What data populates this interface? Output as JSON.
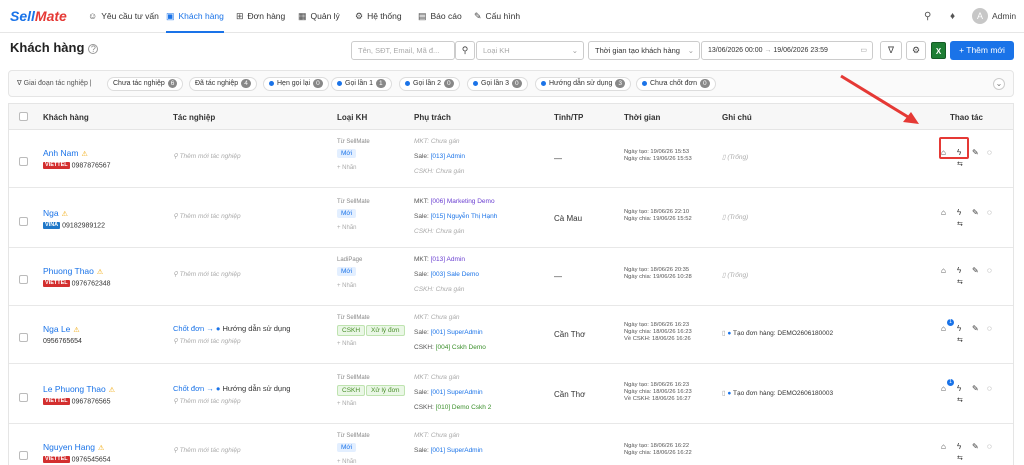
{
  "nav": {
    "logo_a": "Sell",
    "logo_b": "Mate",
    "items": [
      {
        "label": "Yêu cầu tư vấn",
        "icon": "chat-icon"
      },
      {
        "label": "Khách hàng",
        "icon": "contact-icon"
      },
      {
        "label": "Đơn hàng",
        "icon": "cart-icon"
      },
      {
        "label": "Quản lý",
        "icon": "grid-icon"
      },
      {
        "label": "Hệ thống",
        "icon": "gear-icon"
      },
      {
        "label": "Báo cáo",
        "icon": "chart-icon"
      },
      {
        "label": "Cấu hình",
        "icon": "wrench-icon"
      }
    ],
    "avatar_letter": "A",
    "user": "Admin"
  },
  "page": {
    "title": "Khách hàng",
    "search_placeholder": "Tên, SĐT, Email, Mã đ...",
    "type_placeholder": "Loại KH",
    "time_filter": "Thời gian tạo khách hàng",
    "date_from": "13/06/2026 00:00",
    "date_to": "19/06/2026 23:59",
    "date_sep": "→",
    "excel": "X",
    "add_button": "+ Thêm mới"
  },
  "filters": {
    "label": "Giai đoạn tác nghiệp",
    "chips": [
      {
        "label": "Chưa tác nghiệp",
        "count": "6"
      },
      {
        "label": "Đã tác nghiệp",
        "count": "4"
      },
      {
        "label": "Hẹn gọi lại",
        "count": "0"
      },
      {
        "label": "Gọi lần 1",
        "count": "1"
      },
      {
        "label": "Gọi lần 2",
        "count": "0"
      },
      {
        "label": "Gọi lần 3",
        "count": "0"
      },
      {
        "label": "Hướng dẫn sử dụng",
        "count": "3"
      },
      {
        "label": "Chưa chốt đơn",
        "count": "0"
      }
    ]
  },
  "table": {
    "headers": [
      "Khách hàng",
      "Tác nghiệp",
      "Loại KH",
      "Phụ trách",
      "Tỉnh/TP",
      "Thời gian",
      "Ghi chú",
      "Thao tác"
    ],
    "add_tn": "Thêm mới tác nghiệp",
    "add_label": "+ Nhãn",
    "empty_note": "(Trống)",
    "rows": [
      {
        "name": "Anh Nam",
        "carrier": "VIETTEL",
        "phone": "0987876567",
        "tn_stage": "",
        "tn_status": "",
        "source": "Từ SellMate",
        "tag": "Mới",
        "tag2": "",
        "mkt": "MKT: Chưa gán",
        "sale": "Sale: ",
        "sale_v": "[013] Admin",
        "cskh": "CSKH: Chưa gán",
        "cskh_v": "",
        "city": "—",
        "t1": "Ngày tạo: 19/06/26 15:53",
        "t2": "Ngày chia: 19/06/26 15:53",
        "t3": "",
        "note": "(Trống)"
      },
      {
        "name": "Nga",
        "carrier": "VINA",
        "phone": "09182989122",
        "tn_stage": "",
        "tn_status": "",
        "source": "Từ SellMate",
        "tag": "Mới",
        "tag2": "",
        "mkt": "MKT: ",
        "mkt_v": "[006] Marketing Demo",
        "sale": "Sale: ",
        "sale_v": "[015] Nguyễn Thị Hạnh",
        "cskh": "CSKH: Chưa gán",
        "cskh_v": "",
        "city": "Cà Mau",
        "t1": "Ngày tạo: 18/06/26 22:10",
        "t2": "Ngày chia: 19/06/26 15:52",
        "t3": "",
        "note": "(Trống)"
      },
      {
        "name": "Phuong Thao",
        "carrier": "VIETTEL",
        "phone": "0976762348",
        "tn_stage": "",
        "tn_status": "",
        "source": "LadiPage",
        "tag": "Mới",
        "tag2": "",
        "mkt": "MKT: ",
        "mkt_v": "[013] Admin",
        "sale": "Sale: ",
        "sale_v": "[003] Sale Demo",
        "cskh": "CSKH: Chưa gán",
        "cskh_v": "",
        "city": "—",
        "t1": "Ngày tạo: 18/06/26 20:35",
        "t2": "Ngày chia: 19/06/26 10:28",
        "t3": "",
        "note": "(Trống)"
      },
      {
        "name": "Nga Le",
        "carrier": "",
        "phone": "0956765654",
        "tn_stage": "Chốt đơn →",
        "tn_status": "Hướng dẫn sử dụng",
        "source": "Từ SellMate",
        "tag": "CSKH",
        "tag2": "Xử lý đơn",
        "mkt": "MKT: Chưa gán",
        "sale": "Sale: ",
        "sale_v": "[001] SuperAdmin",
        "cskh": "CSKH: ",
        "cskh_v": "[004] Cskh Demo",
        "city": "Cần Thơ",
        "t1": "Ngày tạo: 18/06/26 16:23",
        "t2": "Ngày chia: 18/06/26 16:23",
        "t3": "Về CSKH: 18/06/26 16:26",
        "note": "Tạo đơn hàng: DEMO2606180002"
      },
      {
        "name": "Le Phuong Thao",
        "carrier": "VIETTEL",
        "phone": "0967876565",
        "tn_stage": "Chốt đơn →",
        "tn_status": "Hướng dẫn sử dụng",
        "source": "Từ SellMate",
        "tag": "CSKH",
        "tag2": "Xử lý đơn",
        "mkt": "MKT: Chưa gán",
        "sale": "Sale: ",
        "sale_v": "[001] SuperAdmin",
        "cskh": "CSKH: ",
        "cskh_v": "[010] Demo Cskh 2",
        "city": "Cần Thơ",
        "t1": "Ngày tạo: 18/06/26 16:23",
        "t2": "Ngày chia: 18/06/26 16:23",
        "t3": "Về CSKH: 18/06/26 16:27",
        "note": "Tạo đơn hàng: DEMO2606180003"
      },
      {
        "name": "Nguyen Hang",
        "carrier": "VIETTEL",
        "phone": "0976545654",
        "tn_stage": "",
        "tn_status": "",
        "source": "Từ SellMate",
        "tag": "Mới",
        "tag2": "",
        "mkt": "MKT: Chưa gán",
        "sale": "Sale: ",
        "sale_v": "[001] SuperAdmin",
        "cskh": "",
        "cskh_v": "",
        "city": "",
        "t1": "Ngày tạo: 18/06/26 16:22",
        "t2": "Ngày chia: 18/06/26 16:22",
        "t3": "",
        "note": ""
      }
    ]
  },
  "colors": {
    "accent": "#1a73e8",
    "highlight": "#e53935"
  }
}
